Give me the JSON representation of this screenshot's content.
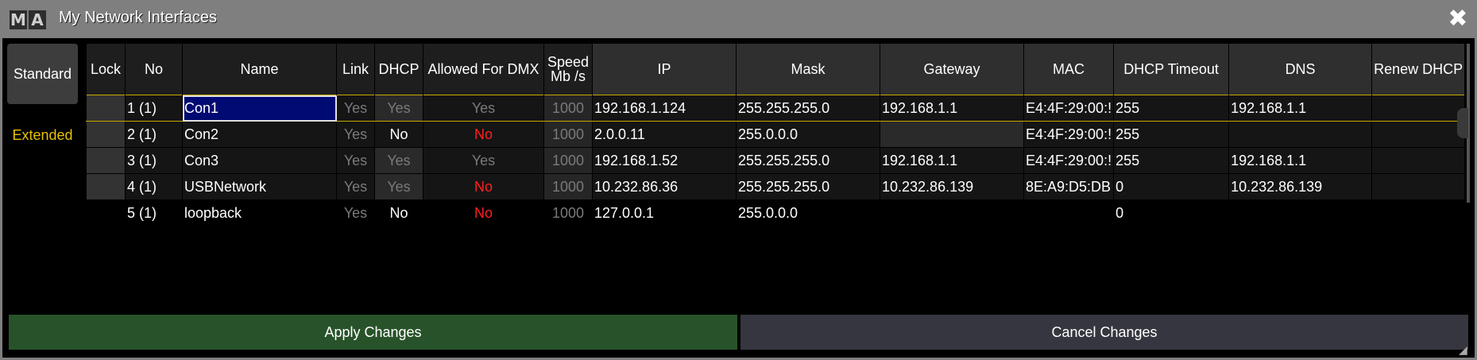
{
  "window": {
    "logo": [
      "M",
      "A"
    ],
    "title": "My Network Interfaces",
    "close_icon": "close-icon"
  },
  "modes": {
    "standard": "Standard",
    "extended": "Extended"
  },
  "columns": {
    "lock": "Lock",
    "no": "No",
    "name": "Name",
    "link": "Link",
    "dhcp": "DHCP",
    "dmx": "Allowed For DMX",
    "speed_top": "Speed",
    "speed_bottom": "Mb /s",
    "ip": "IP",
    "mask": "Mask",
    "gateway": "Gateway",
    "mac": "MAC",
    "dhcp_timeout": "DHCP Timeout",
    "dns": "DNS",
    "renew": "Renew DHCP"
  },
  "rows": [
    {
      "no": "1 (1)",
      "name": "Con1",
      "link": "Yes",
      "dhcp": "Yes",
      "dmx": "Yes",
      "speed": "1000",
      "ip": "192.168.1.124",
      "mask": "255.255.255.0",
      "gateway": "192.168.1.1",
      "mac": "E4:4F:29:00:!",
      "timeout": "255",
      "dns": "192.168.1.1",
      "renew": ""
    },
    {
      "no": "2 (1)",
      "name": "Con2",
      "link": "Yes",
      "dhcp": "No",
      "dmx": "No",
      "speed": "1000",
      "ip": "2.0.0.11",
      "mask": "255.0.0.0",
      "gateway": "",
      "mac": "E4:4F:29:00:!",
      "timeout": "255",
      "dns": "",
      "renew": ""
    },
    {
      "no": "3 (1)",
      "name": "Con3",
      "link": "Yes",
      "dhcp": "Yes",
      "dmx": "Yes",
      "speed": "1000",
      "ip": "192.168.1.52",
      "mask": "255.255.255.0",
      "gateway": "192.168.1.1",
      "mac": "E4:4F:29:00:!",
      "timeout": "255",
      "dns": "192.168.1.1",
      "renew": ""
    },
    {
      "no": "4 (1)",
      "name": "USBNetwork",
      "link": "Yes",
      "dhcp": "Yes",
      "dmx": "No",
      "speed": "1000",
      "ip": "10.232.86.36",
      "mask": "255.255.255.0",
      "gateway": "10.232.86.139",
      "mac": "8E:A9:D5:DB",
      "timeout": "0",
      "dns": "10.232.86.139",
      "renew": ""
    },
    {
      "no": "5 (1)",
      "name": "loopback",
      "link": "Yes",
      "dhcp": "No",
      "dmx": "No",
      "speed": "1000",
      "ip": "127.0.0.1",
      "mask": "255.0.0.0",
      "gateway": "",
      "mac": "",
      "timeout": "0",
      "dns": "",
      "renew": ""
    }
  ],
  "buttons": {
    "apply": "Apply Changes",
    "cancel": "Cancel Changes"
  },
  "colors": {
    "accent": "#e8c200",
    "no_value": "#ff2020",
    "selection": "#000a73",
    "apply_bg": "#28532a"
  }
}
